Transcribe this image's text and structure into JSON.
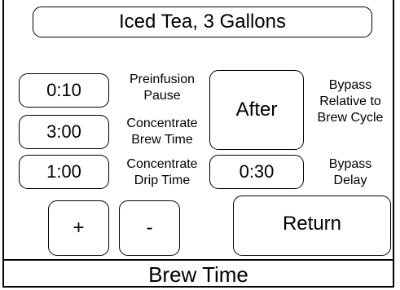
{
  "header": {
    "title": "Iced Tea, 3 Gallons"
  },
  "settings": {
    "preinfusion": {
      "value": "0:10",
      "label_line1": "Preinfusion",
      "label_line2": "Pause"
    },
    "concentrate_brew": {
      "value": "3:00",
      "label_line1": "Concentrate",
      "label_line2": "Brew Time"
    },
    "concentrate_drip": {
      "value": "1:00",
      "label_line1": "Concentrate",
      "label_line2": "Drip Time"
    },
    "bypass_relative": {
      "value": "After",
      "label_line1": "Bypass",
      "label_line2": "Relative to",
      "label_line3": "Brew Cycle"
    },
    "bypass_delay": {
      "value": "0:30",
      "label_line1": "Bypass",
      "label_line2": "Delay"
    }
  },
  "controls": {
    "plus_label": "+",
    "minus_label": "-",
    "return_label": "Return"
  },
  "footer": {
    "status": "Brew Time"
  }
}
